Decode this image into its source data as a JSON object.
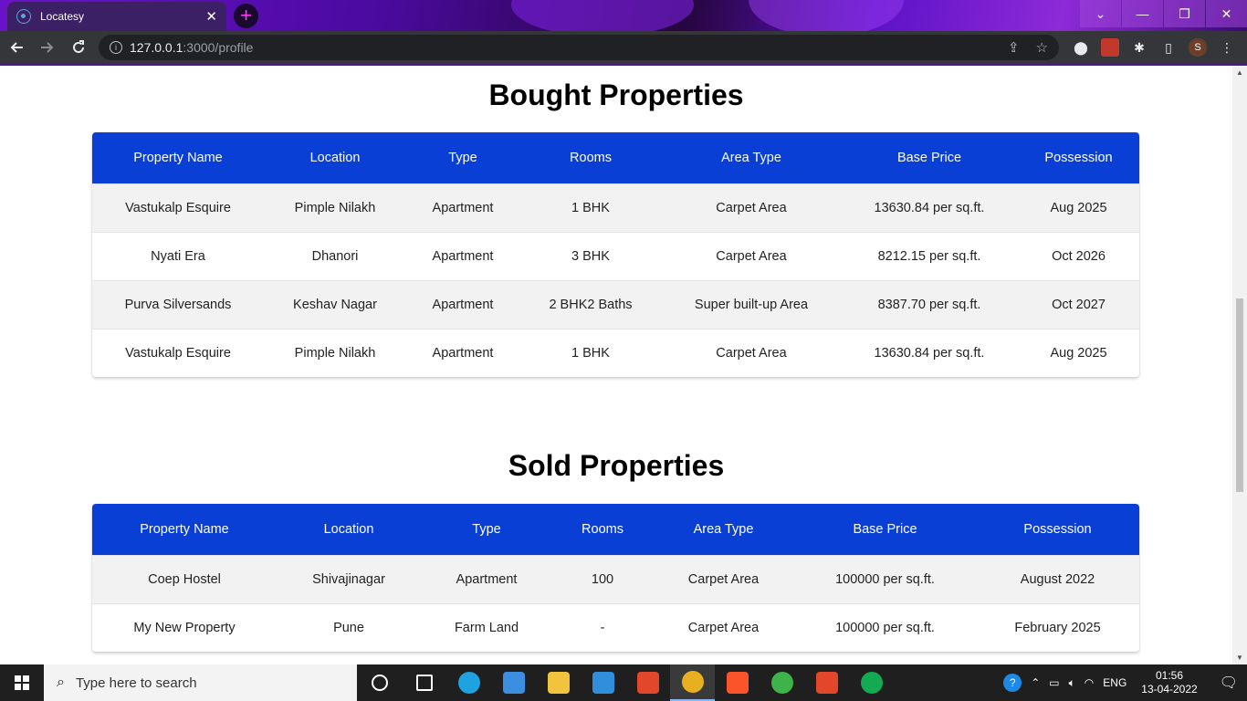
{
  "browser": {
    "tab_title": "Locatesy",
    "close_glyph": "✕",
    "new_tab_glyph": "+",
    "url_host": "127.0.0.1",
    "url_path": ":3000/profile",
    "profile_initial": "S",
    "window_controls": [
      "⌄",
      "—",
      "❐",
      "✕"
    ]
  },
  "bought": {
    "title": "Bought Properties",
    "columns": [
      "Property Name",
      "Location",
      "Type",
      "Rooms",
      "Area Type",
      "Base Price",
      "Possession"
    ],
    "rows": [
      [
        "Vastukalp Esquire",
        "Pimple Nilakh",
        "Apartment",
        "1 BHK",
        "Carpet Area",
        "13630.84 per sq.ft.",
        "Aug 2025"
      ],
      [
        "Nyati Era",
        "Dhanori",
        "Apartment",
        "3 BHK",
        "Carpet Area",
        "8212.15 per sq.ft.",
        "Oct 2026"
      ],
      [
        "Purva Silversands",
        "Keshav Nagar",
        "Apartment",
        "2 BHK2 Baths",
        "Super built-up Area",
        "8387.70 per sq.ft.",
        "Oct 2027"
      ],
      [
        "Vastukalp Esquire",
        "Pimple Nilakh",
        "Apartment",
        "1 BHK",
        "Carpet Area",
        "13630.84 per sq.ft.",
        "Aug 2025"
      ]
    ]
  },
  "sold": {
    "title": "Sold Properties",
    "columns": [
      "Property Name",
      "Location",
      "Type",
      "Rooms",
      "Area Type",
      "Base Price",
      "Possession"
    ],
    "rows": [
      [
        "Coep Hostel",
        "Shivajinagar",
        "Apartment",
        "100",
        "Carpet Area",
        "100000 per sq.ft.",
        "August 2022"
      ],
      [
        "My New Property",
        "Pune",
        "Farm Land",
        "-",
        "Carpet Area",
        "100000 per sq.ft.",
        "February 2025"
      ]
    ]
  },
  "taskbar": {
    "search_placeholder": "Type here to search",
    "language": "ENG",
    "time": "01:56",
    "date": "13-04-2022",
    "apps": [
      {
        "name": "task-view-icon",
        "color": "#ffffff"
      },
      {
        "name": "multitask-icon",
        "color": "#ffffff"
      },
      {
        "name": "edge-icon",
        "color": "#1ea2e0"
      },
      {
        "name": "mail-icon",
        "color": "#3b8ee0"
      },
      {
        "name": "file-explorer-icon",
        "color": "#f2c33c"
      },
      {
        "name": "vscode-icon",
        "color": "#2f8fdd"
      },
      {
        "name": "office-icon",
        "color": "#e2462b"
      },
      {
        "name": "chrome-icon",
        "color": "#e8b020"
      },
      {
        "name": "brave-icon",
        "color": "#fb542b"
      },
      {
        "name": "spinner-app-icon",
        "color": "#3db34a"
      },
      {
        "name": "office-alt-icon",
        "color": "#e2462b"
      },
      {
        "name": "mongodb-compass-icon",
        "color": "#13aa52"
      }
    ]
  }
}
